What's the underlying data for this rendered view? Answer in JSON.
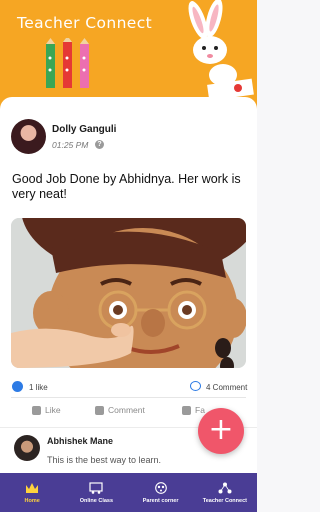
{
  "app": {
    "title": "Teacher Connect"
  },
  "post": {
    "author": "Dolly Ganguli",
    "time": "01:25 PM",
    "text": "Good Job Done by Abhidnya. Her work is very neat!",
    "likes": "1 like",
    "comments": "4 Comment",
    "actions": {
      "like": "Like",
      "comment": "Comment",
      "share": "Fa"
    }
  },
  "latest_comment": {
    "author": "Abhishek Mane",
    "text": "This is the best way to learn."
  },
  "nav": {
    "items": [
      {
        "label": "Home",
        "icon": "crown-icon"
      },
      {
        "label": "Online Class",
        "icon": "classroom-icon"
      },
      {
        "label": "Parent corner",
        "icon": "family-icon"
      },
      {
        "label": "Teacher Connect",
        "icon": "connect-icon"
      }
    ]
  },
  "colors": {
    "header": "#f6a623",
    "nav": "#4a3d95",
    "fab": "#f0566a",
    "accent": "#2d7be5",
    "active_nav": "#ffd33d"
  },
  "fab": {
    "label": "+"
  }
}
